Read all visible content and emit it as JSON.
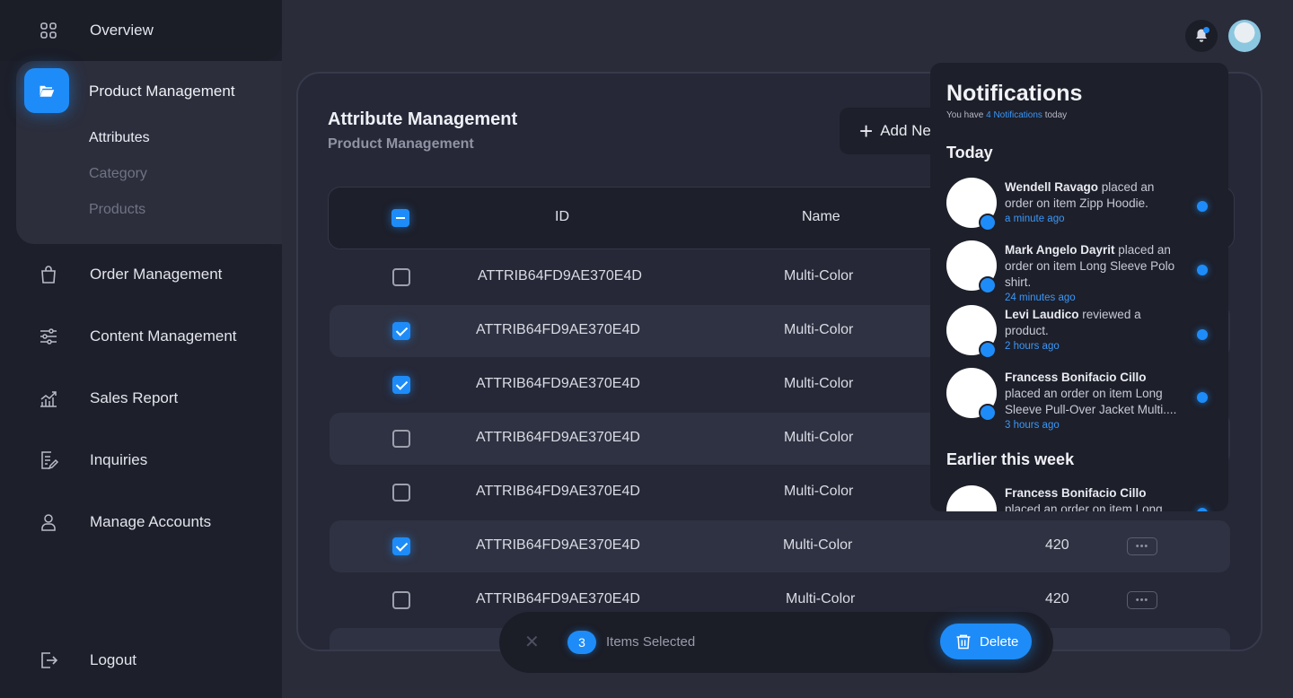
{
  "sidebar": {
    "overview": "Overview",
    "product_management": "Product Management",
    "sub_items": [
      "Attributes",
      "Category",
      "Products"
    ],
    "order_management": "Order Management",
    "content_management": "Content Management",
    "sales_report": "Sales Report",
    "inquiries": "Inquiries",
    "manage_accounts": "Manage Accounts",
    "logout": "Logout"
  },
  "header": {
    "title": "Attribute Management",
    "subtitle": "Product Management",
    "add_button": "Add Ne"
  },
  "table": {
    "columns": [
      "ID",
      "Name"
    ],
    "rows": [
      {
        "id": "ATTRIB64FD9AE370E4D",
        "name": "Multi-Color",
        "value": "",
        "checked": false
      },
      {
        "id": "ATTRIB64FD9AE370E4D",
        "name": "Multi-Color",
        "value": "",
        "checked": true
      },
      {
        "id": "ATTRIB64FD9AE370E4D",
        "name": "Multi-Color",
        "value": "",
        "checked": true
      },
      {
        "id": "ATTRIB64FD9AE370E4D",
        "name": "Multi-Color",
        "value": "",
        "checked": false
      },
      {
        "id": "ATTRIB64FD9AE370E4D",
        "name": "Multi-Color",
        "value": "",
        "checked": false
      },
      {
        "id": "ATTRIB64FD9AE370E4D",
        "name": "Multi-Color",
        "value": "420",
        "checked": true
      },
      {
        "id": "ATTRIB64FD9AE370E4D",
        "name": "Multi-Color",
        "value": "420",
        "checked": false
      }
    ]
  },
  "selection": {
    "count": "3",
    "label": "Items Selected",
    "delete_label": "Delete"
  },
  "notifications": {
    "title": "Notifications",
    "summary_prefix": "You have",
    "summary_count": "4 Notifications",
    "summary_suffix": "today",
    "today_label": "Today",
    "earlier_label": "Earlier this week",
    "today": [
      {
        "name": "Wendell Ravago",
        "text": "placed an order on item Zipp Hoodie.",
        "time": "a minute ago"
      },
      {
        "name": "Mark Angelo Dayrit",
        "text": "placed an order on item Long Sleeve Polo shirt.",
        "time": "24 minutes ago"
      },
      {
        "name": "Levi Laudico",
        "text": "reviewed a product.",
        "time": "2 hours ago"
      },
      {
        "name": "Francess Bonifacio Cillo",
        "text": "placed an order on item Long Sleeve Pull-Over Jacket Multi....",
        "time": "3 hours ago"
      }
    ],
    "earlier": [
      {
        "name": "Francess Bonifacio Cillo",
        "text": "placed an order on item Long"
      }
    ]
  },
  "colors": {
    "accent": "#1e8cf8",
    "background": "#2a2c3a",
    "sidebar": "#1d1f2a"
  },
  "icons": [
    "grid-icon",
    "folder-icon",
    "shopping-bag-icon",
    "sliders-icon",
    "chart-icon",
    "edit-document-icon",
    "user-icon",
    "logout-icon",
    "bell-icon",
    "trash-icon",
    "plus-icon",
    "close-icon"
  ]
}
